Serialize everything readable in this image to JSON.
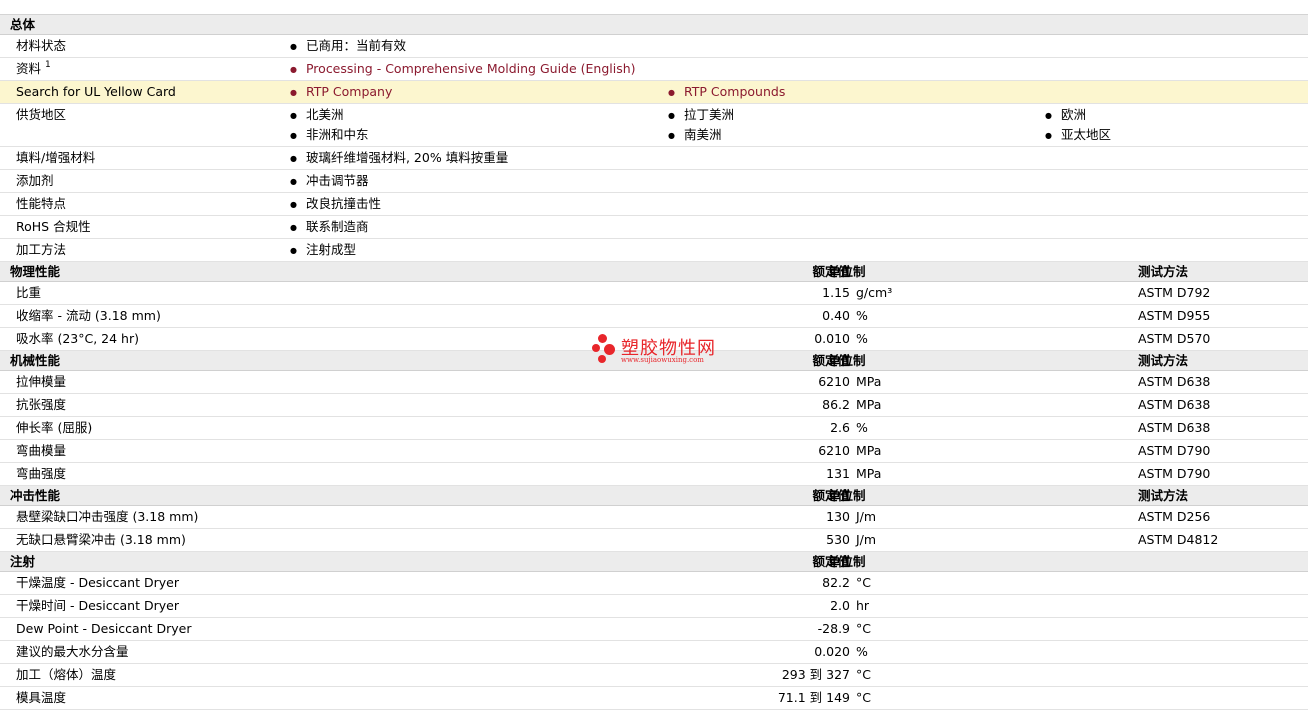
{
  "general": {
    "title": "总体",
    "rows": [
      {
        "label": "材料状态",
        "items": [
          [
            "已商用：当前有效"
          ]
        ]
      },
      {
        "label": "资料",
        "sup": "1",
        "items": [
          [
            "Processing - Comprehensive Molding Guide (English)"
          ]
        ]
      },
      {
        "label": "Search for UL Yellow Card",
        "items": [
          [
            "RTP Company",
            "RTP Compounds"
          ]
        ]
      },
      {
        "label": "供货地区",
        "items": [
          [
            "北美洲",
            "拉丁美洲",
            "欧洲"
          ],
          [
            "非洲和中东",
            "南美洲",
            "亚太地区"
          ]
        ]
      },
      {
        "label": "填料/增强材料",
        "items": [
          [
            "玻璃纤维增强材料, 20% 填料按重量"
          ]
        ]
      },
      {
        "label": "添加剂",
        "items": [
          [
            "冲击调节器"
          ]
        ]
      },
      {
        "label": "性能特点",
        "items": [
          [
            "改良抗撞击性"
          ]
        ]
      },
      {
        "label": "RoHS 合规性",
        "items": [
          [
            "联系制造商"
          ]
        ]
      },
      {
        "label": "加工方法",
        "items": [
          [
            "注射成型"
          ]
        ]
      }
    ]
  },
  "headers": {
    "nominal": "额定值",
    "unit": "单位制",
    "test": "测试方法"
  },
  "sections": [
    {
      "title": "物理性能",
      "rows": [
        {
          "label": "比重",
          "value": "1.15",
          "unit": "g/cm³",
          "test": "ASTM D792"
        },
        {
          "label": "收缩率  - 流动  (3.18 mm)",
          "value": "0.40",
          "unit": "%",
          "test": "ASTM D955"
        },
        {
          "label": "吸水率  (23°C, 24 hr)",
          "value": "0.010",
          "unit": "%",
          "test": "ASTM D570"
        }
      ]
    },
    {
      "title": "机械性能",
      "rows": [
        {
          "label": "拉伸模量",
          "value": "6210",
          "unit": "MPa",
          "test": "ASTM D638"
        },
        {
          "label": "抗张强度",
          "value": "86.2",
          "unit": "MPa",
          "test": "ASTM D638"
        },
        {
          "label": "伸长率  (屈服)",
          "value": "2.6",
          "unit": "%",
          "test": "ASTM D638"
        },
        {
          "label": "弯曲模量",
          "value": "6210",
          "unit": "MPa",
          "test": "ASTM D790"
        },
        {
          "label": "弯曲强度",
          "value": "131",
          "unit": "MPa",
          "test": "ASTM D790"
        }
      ]
    },
    {
      "title": "冲击性能",
      "rows": [
        {
          "label": "悬壁梁缺口冲击强度  (3.18 mm)",
          "value": "130",
          "unit": "J/m",
          "test": "ASTM D256"
        },
        {
          "label": "无缺口悬臂梁冲击  (3.18 mm)",
          "value": "530",
          "unit": "J/m",
          "test": "ASTM D4812"
        }
      ]
    },
    {
      "title": "注射",
      "noTest": true,
      "rows": [
        {
          "label": "干燥温度  - Desiccant Dryer",
          "value": "82.2",
          "unit": "°C",
          "test": ""
        },
        {
          "label": "干燥时间  - Desiccant Dryer",
          "value": "2.0",
          "unit": "hr",
          "test": ""
        },
        {
          "label": "Dew Point - Desiccant Dryer",
          "value": "-28.9",
          "unit": "°C",
          "test": ""
        },
        {
          "label": "建议的最大水分含量",
          "value": "0.020",
          "unit": "%",
          "test": ""
        },
        {
          "label": "加工（熔体）温度",
          "value": "293 到  327",
          "unit": "°C",
          "test": ""
        },
        {
          "label": "模具温度",
          "value": "71.1 到  149",
          "unit": "°C",
          "test": ""
        }
      ]
    }
  ],
  "watermark": {
    "name": "塑胶物性网",
    "url": "www.sujiaowuxing.com",
    "color": "#e8262b"
  },
  "colors": {
    "link": "#8b1a2f",
    "highlight_row": "#fcf6cf",
    "section_bg": "#ececec"
  }
}
